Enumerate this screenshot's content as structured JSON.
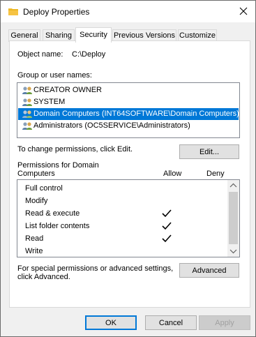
{
  "window": {
    "title": "Deploy Properties"
  },
  "tabs": [
    {
      "label": "General"
    },
    {
      "label": "Sharing"
    },
    {
      "label": "Security"
    },
    {
      "label": "Previous Versions"
    },
    {
      "label": "Customize"
    }
  ],
  "security": {
    "object_name_label": "Object name:",
    "object_name_value": "C:\\Deploy",
    "group_label": "Group or user names:",
    "users": [
      {
        "name": "CREATOR OWNER"
      },
      {
        "name": "SYSTEM"
      },
      {
        "name": "Domain Computers (INT64SOFTWARE\\Domain Computers)"
      },
      {
        "name": "Administrators (OC5SERVICE\\Administrators)"
      }
    ],
    "change_text": "To change permissions, click Edit.",
    "edit_button": "Edit...",
    "perms_for_line1": "Permissions for Domain",
    "perms_for_line2": "Computers",
    "allow_header": "Allow",
    "deny_header": "Deny",
    "permissions": [
      {
        "name": "Full control",
        "allow": false
      },
      {
        "name": "Modify",
        "allow": false
      },
      {
        "name": "Read & execute",
        "allow": true
      },
      {
        "name": "List folder contents",
        "allow": true
      },
      {
        "name": "Read",
        "allow": true
      },
      {
        "name": "Write",
        "allow": false
      }
    ],
    "special_line1": "For special permissions or advanced settings,",
    "special_line2": "click Advanced.",
    "advanced_button": "Advanced"
  },
  "footer": {
    "ok": "OK",
    "cancel": "Cancel",
    "apply": "Apply"
  },
  "colors": {
    "selection": "#0078d7",
    "folder": "#f6c343"
  },
  "icons": [
    "folder-icon",
    "close-icon",
    "users-icon",
    "checkmark-icon",
    "scroll-up-icon",
    "scroll-down-icon"
  ]
}
